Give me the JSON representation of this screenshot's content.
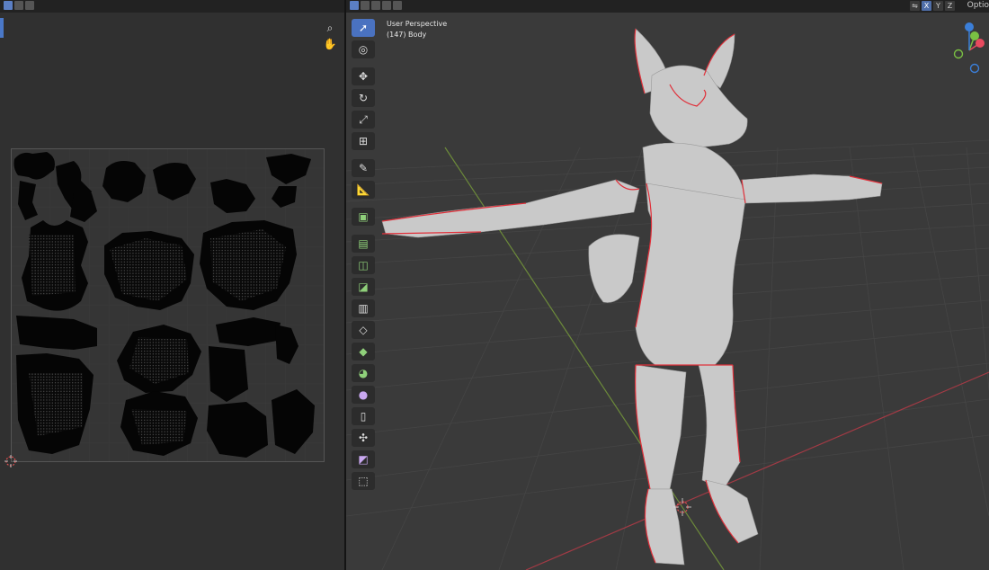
{
  "viewport": {
    "view_name": "User Perspective",
    "object_info": "(147) Body"
  },
  "header": {
    "axis_toggles": [
      "X",
      "Y",
      "Z"
    ],
    "options_label": "Optio"
  },
  "toolbar_tools": [
    {
      "icon": "select-box-icon",
      "active": true
    },
    {
      "icon": "cursor-icon"
    },
    {
      "icon": "move-icon"
    },
    {
      "icon": "rotate-icon"
    },
    {
      "icon": "scale-icon"
    },
    {
      "icon": "transform-icon"
    },
    {
      "icon": "annotate-icon"
    },
    {
      "icon": "measure-icon"
    },
    {
      "icon": "add-cube-icon"
    },
    {
      "icon": "extrude-region-icon"
    },
    {
      "icon": "inset-faces-icon"
    },
    {
      "icon": "bevel-icon"
    },
    {
      "icon": "loop-cut-icon"
    },
    {
      "icon": "knife-icon"
    },
    {
      "icon": "poly-build-icon"
    },
    {
      "icon": "spin-icon"
    },
    {
      "icon": "smooth-icon"
    },
    {
      "icon": "edge-slide-icon"
    },
    {
      "icon": "shrink-fatten-icon"
    },
    {
      "icon": "shear-icon"
    },
    {
      "icon": "rip-region-icon"
    }
  ],
  "uv_tools": [
    {
      "icon": "zoom-icon"
    },
    {
      "icon": "pan-hand-icon"
    }
  ],
  "gizmo_colors": {
    "x": "#e84a5f",
    "y": "#7ac043",
    "z": "#3b7fd9"
  }
}
